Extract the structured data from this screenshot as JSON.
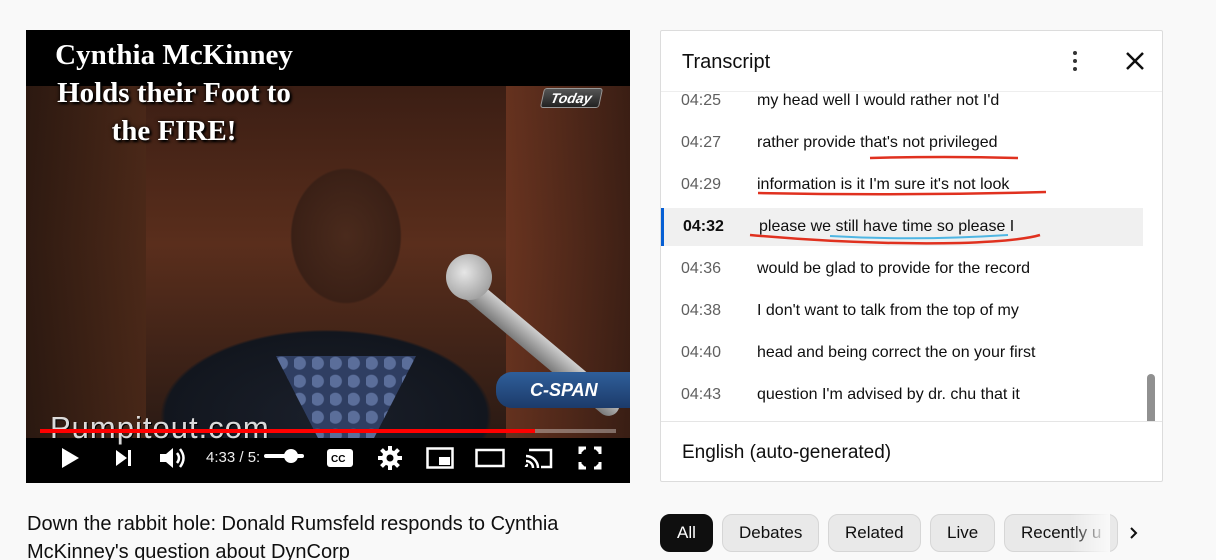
{
  "player": {
    "overlay_title_lines": [
      "Cynthia McKinney",
      "Holds their Foot to",
      "the FIRE!"
    ],
    "badge_today": "Today",
    "badge_network": "C-SPAN",
    "watermark": "Pumpitout.com",
    "time_display": "4:33 / 5:",
    "progress_fraction": 0.86,
    "accent_color": "#ff0000"
  },
  "transcript": {
    "title": "Transcript",
    "language": "English (auto-generated)",
    "segments": [
      {
        "time": "04:25",
        "text": "my head well I would rather not I'd"
      },
      {
        "time": "04:27",
        "text": "rather provide that's not privileged"
      },
      {
        "time": "04:29",
        "text": "information is it I'm sure it's not look"
      },
      {
        "time": "04:32",
        "text": "please we still have time so please I",
        "active": true
      },
      {
        "time": "04:36",
        "text": "would be glad to provide for the record"
      },
      {
        "time": "04:38",
        "text": "I don't want to talk from the top of my"
      },
      {
        "time": "04:40",
        "text": "head and being correct the on your first"
      },
      {
        "time": "04:43",
        "text": "question I'm advised by dr. chu that it"
      }
    ]
  },
  "video": {
    "title": "Down the rabbit hole: Donald Rumsfeld responds to Cynthia McKinney's question about DynCorp"
  },
  "chips": [
    "All",
    "Debates",
    "Related",
    "Live",
    "Recently u"
  ],
  "colors": {
    "annotation_red": "#e0311f",
    "annotation_blue": "#4fb6e3",
    "active_marker": "#065fd4"
  },
  "icons": [
    "play-icon",
    "next-icon",
    "volume-icon",
    "captions-icon",
    "settings-icon",
    "miniplayer-icon",
    "theater-icon",
    "cast-icon",
    "fullscreen-icon",
    "more-vert-icon",
    "close-icon",
    "chevron-right-icon"
  ]
}
